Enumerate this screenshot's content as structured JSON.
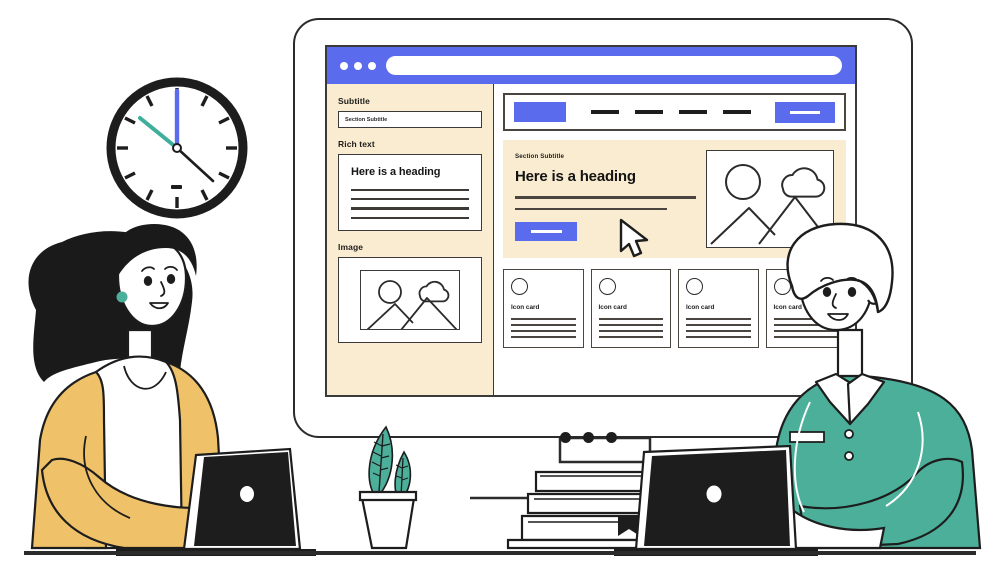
{
  "scene": {
    "title": "Two people at desk with website wireframe on monitor",
    "colors": {
      "brand_blue": "#5B6BEE",
      "cream": "#FAECD0",
      "teal": "#4CAF9A",
      "mustard": "#EFC169",
      "ink": "#1D1D1D",
      "white": "#FFFFFF"
    }
  },
  "browser": {
    "titlebar": {
      "dots": [
        "dot-1",
        "dot-2",
        "dot-3"
      ],
      "url_value": "",
      "url_placeholder": ""
    }
  },
  "sidebar": {
    "fields": [
      {
        "label": "Subtitle",
        "type": "input",
        "value": "Section Subtitle"
      },
      {
        "label": "Rich text",
        "type": "richtext",
        "heading": "Here is a heading",
        "lines": 4
      },
      {
        "label": "Image",
        "type": "image",
        "icons": [
          "circle-icon",
          "cloud-icon",
          "mountains-icon"
        ]
      }
    ]
  },
  "main": {
    "navbar": {
      "logo": "logo-block",
      "links": [
        "link-1",
        "link-2",
        "link-3",
        "link-4"
      ],
      "cta_label": ""
    },
    "hero": {
      "subtitle": "Section Subtitle",
      "heading": "Here is a heading",
      "body_lines": 2,
      "button_label": "",
      "image_icons": [
        "circle-icon",
        "cloud-icon",
        "mountains-icon"
      ],
      "cursor": "cursor-arrow"
    },
    "cards": [
      {
        "icon": "circle-icon",
        "label": "Icon card",
        "lines": 4
      },
      {
        "icon": "circle-icon",
        "label": "Icon card",
        "lines": 4
      },
      {
        "icon": "circle-icon",
        "label": "Icon card",
        "lines": 4
      },
      {
        "icon": "circle-icon",
        "label": "Icon card",
        "lines": 4
      }
    ]
  },
  "monitor": {
    "base_dots": [
      "base-dot-1",
      "base-dot-2",
      "base-dot-3"
    ]
  },
  "clock": {
    "hands": {
      "minute_hand_color": "#5B6BEE",
      "second_hand_color": "#3FAE9A",
      "hour_hand_color": "#1D1D1D"
    },
    "tick_count": 12
  },
  "people": {
    "left": {
      "name": "woman-character",
      "hair_color": "#1A1A1A",
      "cardigan_color": "#EFC169",
      "top_color": "#FFFFFF",
      "earring_color": "#4CAF9A"
    },
    "right": {
      "name": "man-character",
      "hair_color": "#FFFFFF",
      "shirt_color": "#4CAF9A",
      "collar_color": "#FFFFFF"
    }
  },
  "props": {
    "laptop_left": "laptop-lid",
    "laptop_right": "laptop-lid",
    "plant": {
      "name": "potted-plant",
      "leaf_color": "#4CAF9A",
      "leaves": 2
    },
    "books": {
      "name": "book-stack",
      "count": 3,
      "bookmark": "black-bookmark"
    }
  }
}
